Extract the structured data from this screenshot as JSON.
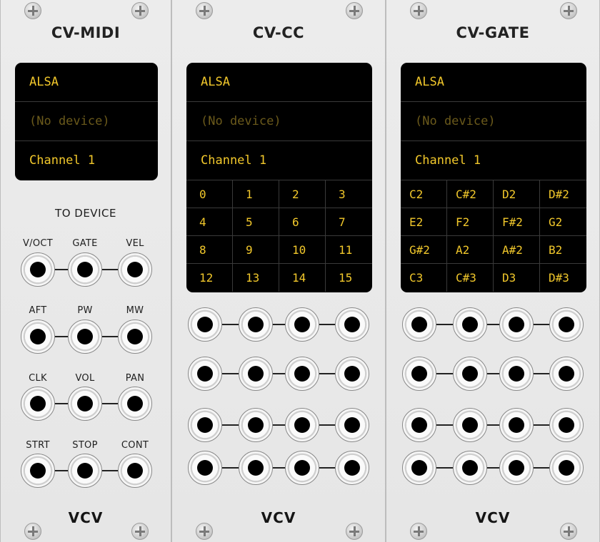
{
  "modules": [
    {
      "title": "CV-MIDI",
      "driver": "ALSA",
      "device": "(No device)",
      "channel": "Channel 1",
      "section_label": "TO DEVICE",
      "jack_labels": [
        "V/OCT",
        "GATE",
        "VEL",
        "AFT",
        "PW",
        "MW",
        "CLK",
        "VOL",
        "PAN",
        "STRT",
        "STOP",
        "CONT"
      ],
      "logo": "VCV"
    },
    {
      "title": "CV-CC",
      "driver": "ALSA",
      "device": "(No device)",
      "channel": "Channel 1",
      "cells": [
        "0",
        "1",
        "2",
        "3",
        "4",
        "5",
        "6",
        "7",
        "8",
        "9",
        "10",
        "11",
        "12",
        "13",
        "14",
        "15"
      ],
      "logo": "VCV"
    },
    {
      "title": "CV-GATE",
      "driver": "ALSA",
      "device": "(No device)",
      "channel": "Channel 1",
      "cells": [
        "C2",
        "C#2",
        "D2",
        "D#2",
        "E2",
        "F2",
        "F#2",
        "G2",
        "G#2",
        "A2",
        "A#2",
        "B2",
        "C3",
        "C#3",
        "D3",
        "D#3"
      ],
      "logo": "VCV"
    }
  ]
}
